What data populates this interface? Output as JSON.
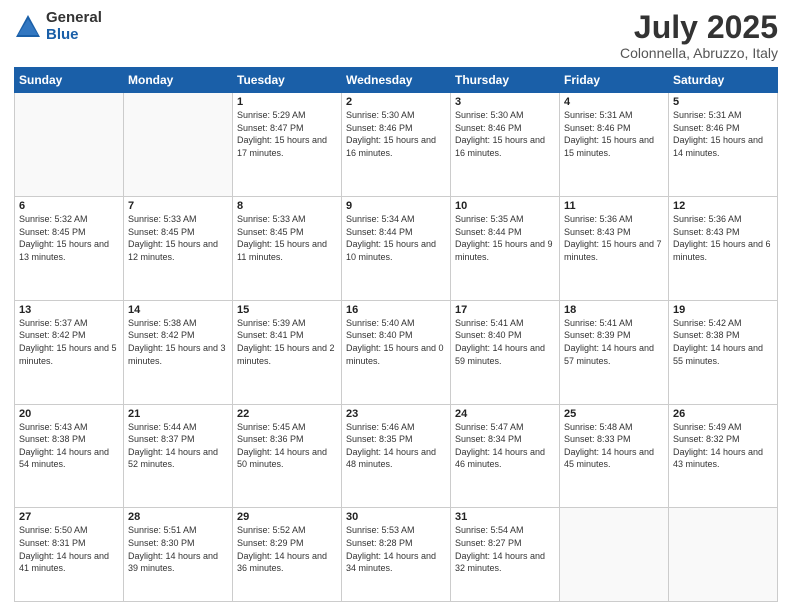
{
  "logo": {
    "general": "General",
    "blue": "Blue"
  },
  "header": {
    "title": "July 2025",
    "subtitle": "Colonnella, Abruzzo, Italy"
  },
  "weekdays": [
    "Sunday",
    "Monday",
    "Tuesday",
    "Wednesday",
    "Thursday",
    "Friday",
    "Saturday"
  ],
  "weeks": [
    [
      {
        "day": "",
        "info": ""
      },
      {
        "day": "",
        "info": ""
      },
      {
        "day": "1",
        "info": "Sunrise: 5:29 AM\nSunset: 8:47 PM\nDaylight: 15 hours and 17 minutes."
      },
      {
        "day": "2",
        "info": "Sunrise: 5:30 AM\nSunset: 8:46 PM\nDaylight: 15 hours and 16 minutes."
      },
      {
        "day": "3",
        "info": "Sunrise: 5:30 AM\nSunset: 8:46 PM\nDaylight: 15 hours and 16 minutes."
      },
      {
        "day": "4",
        "info": "Sunrise: 5:31 AM\nSunset: 8:46 PM\nDaylight: 15 hours and 15 minutes."
      },
      {
        "day": "5",
        "info": "Sunrise: 5:31 AM\nSunset: 8:46 PM\nDaylight: 15 hours and 14 minutes."
      }
    ],
    [
      {
        "day": "6",
        "info": "Sunrise: 5:32 AM\nSunset: 8:45 PM\nDaylight: 15 hours and 13 minutes."
      },
      {
        "day": "7",
        "info": "Sunrise: 5:33 AM\nSunset: 8:45 PM\nDaylight: 15 hours and 12 minutes."
      },
      {
        "day": "8",
        "info": "Sunrise: 5:33 AM\nSunset: 8:45 PM\nDaylight: 15 hours and 11 minutes."
      },
      {
        "day": "9",
        "info": "Sunrise: 5:34 AM\nSunset: 8:44 PM\nDaylight: 15 hours and 10 minutes."
      },
      {
        "day": "10",
        "info": "Sunrise: 5:35 AM\nSunset: 8:44 PM\nDaylight: 15 hours and 9 minutes."
      },
      {
        "day": "11",
        "info": "Sunrise: 5:36 AM\nSunset: 8:43 PM\nDaylight: 15 hours and 7 minutes."
      },
      {
        "day": "12",
        "info": "Sunrise: 5:36 AM\nSunset: 8:43 PM\nDaylight: 15 hours and 6 minutes."
      }
    ],
    [
      {
        "day": "13",
        "info": "Sunrise: 5:37 AM\nSunset: 8:42 PM\nDaylight: 15 hours and 5 minutes."
      },
      {
        "day": "14",
        "info": "Sunrise: 5:38 AM\nSunset: 8:42 PM\nDaylight: 15 hours and 3 minutes."
      },
      {
        "day": "15",
        "info": "Sunrise: 5:39 AM\nSunset: 8:41 PM\nDaylight: 15 hours and 2 minutes."
      },
      {
        "day": "16",
        "info": "Sunrise: 5:40 AM\nSunset: 8:40 PM\nDaylight: 15 hours and 0 minutes."
      },
      {
        "day": "17",
        "info": "Sunrise: 5:41 AM\nSunset: 8:40 PM\nDaylight: 14 hours and 59 minutes."
      },
      {
        "day": "18",
        "info": "Sunrise: 5:41 AM\nSunset: 8:39 PM\nDaylight: 14 hours and 57 minutes."
      },
      {
        "day": "19",
        "info": "Sunrise: 5:42 AM\nSunset: 8:38 PM\nDaylight: 14 hours and 55 minutes."
      }
    ],
    [
      {
        "day": "20",
        "info": "Sunrise: 5:43 AM\nSunset: 8:38 PM\nDaylight: 14 hours and 54 minutes."
      },
      {
        "day": "21",
        "info": "Sunrise: 5:44 AM\nSunset: 8:37 PM\nDaylight: 14 hours and 52 minutes."
      },
      {
        "day": "22",
        "info": "Sunrise: 5:45 AM\nSunset: 8:36 PM\nDaylight: 14 hours and 50 minutes."
      },
      {
        "day": "23",
        "info": "Sunrise: 5:46 AM\nSunset: 8:35 PM\nDaylight: 14 hours and 48 minutes."
      },
      {
        "day": "24",
        "info": "Sunrise: 5:47 AM\nSunset: 8:34 PM\nDaylight: 14 hours and 46 minutes."
      },
      {
        "day": "25",
        "info": "Sunrise: 5:48 AM\nSunset: 8:33 PM\nDaylight: 14 hours and 45 minutes."
      },
      {
        "day": "26",
        "info": "Sunrise: 5:49 AM\nSunset: 8:32 PM\nDaylight: 14 hours and 43 minutes."
      }
    ],
    [
      {
        "day": "27",
        "info": "Sunrise: 5:50 AM\nSunset: 8:31 PM\nDaylight: 14 hours and 41 minutes."
      },
      {
        "day": "28",
        "info": "Sunrise: 5:51 AM\nSunset: 8:30 PM\nDaylight: 14 hours and 39 minutes."
      },
      {
        "day": "29",
        "info": "Sunrise: 5:52 AM\nSunset: 8:29 PM\nDaylight: 14 hours and 36 minutes."
      },
      {
        "day": "30",
        "info": "Sunrise: 5:53 AM\nSunset: 8:28 PM\nDaylight: 14 hours and 34 minutes."
      },
      {
        "day": "31",
        "info": "Sunrise: 5:54 AM\nSunset: 8:27 PM\nDaylight: 14 hours and 32 minutes."
      },
      {
        "day": "",
        "info": ""
      },
      {
        "day": "",
        "info": ""
      }
    ]
  ]
}
